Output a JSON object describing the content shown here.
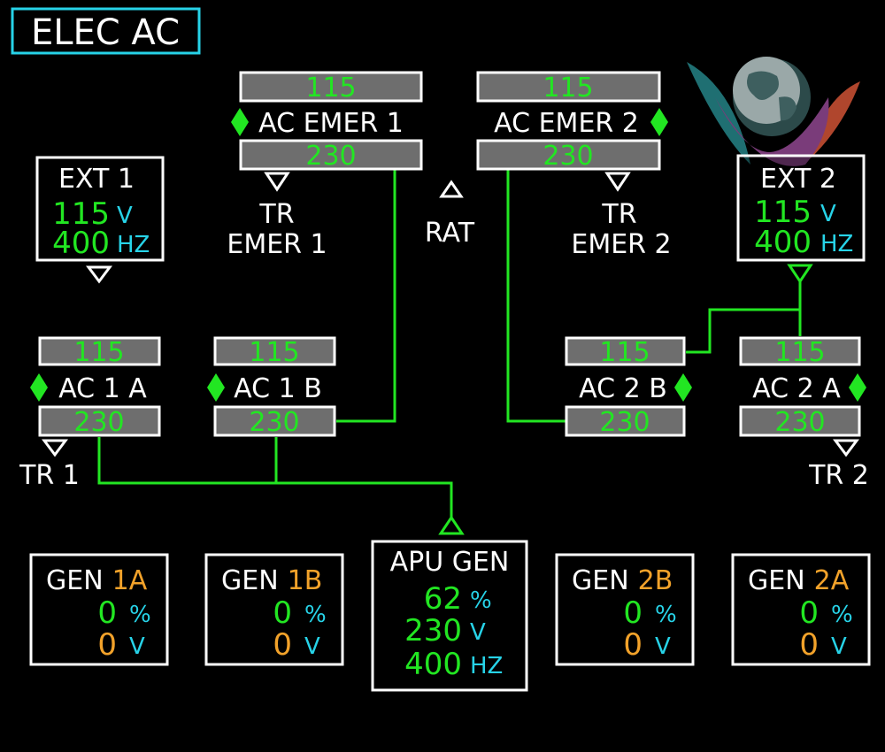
{
  "page_title": "ELEC AC",
  "colors": {
    "green": "#22e622",
    "cyan": "#27d3e8",
    "amber": "#f2a22a",
    "white": "#ffffff",
    "box_gray": "#6e6e6e"
  },
  "buses": {
    "ac_emer_1": {
      "label": "AC EMER 1",
      "top": "115",
      "bottom": "230"
    },
    "ac_emer_2": {
      "label": "AC EMER 2",
      "top": "115",
      "bottom": "230"
    },
    "ac_1a": {
      "label": "AC 1 A",
      "top": "115",
      "bottom": "230"
    },
    "ac_1b": {
      "label": "AC 1 B",
      "top": "115",
      "bottom": "230"
    },
    "ac_2b": {
      "label": "AC 2 B",
      "top": "115",
      "bottom": "230"
    },
    "ac_2a": {
      "label": "AC 2 A",
      "top": "115",
      "bottom": "230"
    }
  },
  "ext_1": {
    "label": "EXT 1",
    "volts": "115",
    "volts_unit": "V",
    "freq": "400",
    "freq_unit": "HZ"
  },
  "ext_2": {
    "label": "EXT 2",
    "volts": "115",
    "volts_unit": "V",
    "freq": "400",
    "freq_unit": "HZ"
  },
  "tr_labels": {
    "tr_emer_1_line1": "TR",
    "tr_emer_1_line2": "EMER 1",
    "tr_emer_2_line1": "TR",
    "tr_emer_2_line2": "EMER 2",
    "tr_1": "TR 1",
    "tr_2": "TR 2",
    "rat": "RAT"
  },
  "generators": {
    "gen_1a": {
      "label": "GEN",
      "id": "1A",
      "load": "0",
      "load_unit": "%",
      "volts": "0",
      "volts_unit": "V"
    },
    "gen_1b": {
      "label": "GEN",
      "id": "1B",
      "load": "0",
      "load_unit": "%",
      "volts": "0",
      "volts_unit": "V"
    },
    "gen_2b": {
      "label": "GEN",
      "id": "2B",
      "load": "0",
      "load_unit": "%",
      "volts": "0",
      "volts_unit": "V"
    },
    "gen_2a": {
      "label": "GEN",
      "id": "2A",
      "load": "0",
      "load_unit": "%",
      "volts": "0",
      "volts_unit": "V"
    }
  },
  "apu_gen": {
    "label": "APU GEN",
    "load": "62",
    "load_unit": "%",
    "volts": "230",
    "volts_unit": "V",
    "freq": "400",
    "freq_unit": "HZ"
  }
}
